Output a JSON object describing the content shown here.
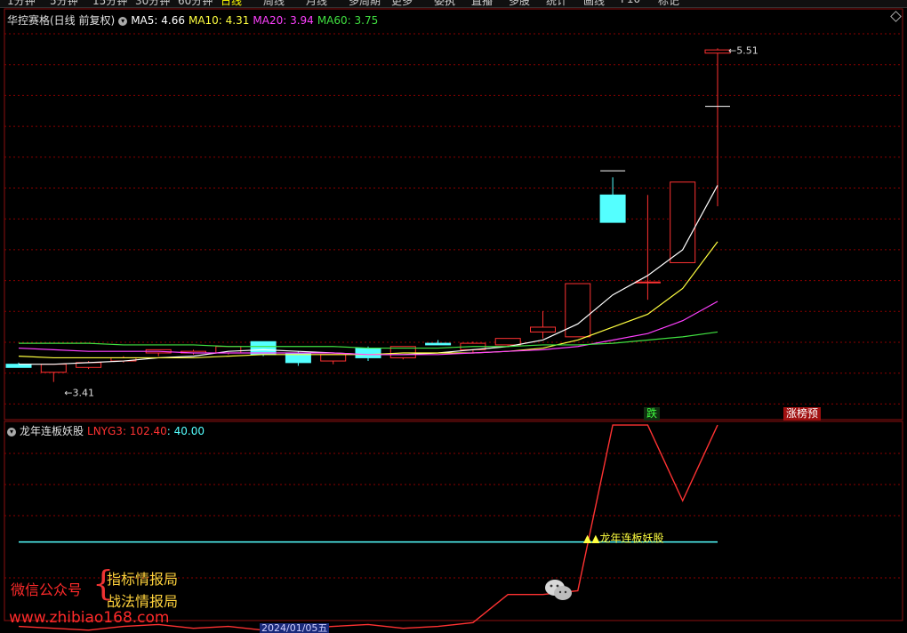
{
  "top_strip": {
    "items": [
      "1分钟",
      "5分钟",
      "15分钟",
      "30分钟",
      "60分钟",
      "日线",
      "周线",
      "月线",
      "多周期",
      "更多",
      "委执",
      "直播",
      "多股",
      "统计",
      "画线",
      "F10",
      "标记"
    ],
    "highlighted": "日线"
  },
  "main_panel": {
    "title": "华控赛格(日线 前复权)",
    "ma_labels": [
      {
        "text": "MA5: 4.66",
        "color": "#ffffff"
      },
      {
        "text": "MA10: 4.31",
        "color": "#ffff40"
      },
      {
        "text": "MA20: 3.94",
        "color": "#ff40ff"
      },
      {
        "text": "MA60: 3.75",
        "color": "#40e040"
      }
    ],
    "high_label": "5.51",
    "low_label": "3.41",
    "signal_die": "跌",
    "signal_zt": "涨榜预"
  },
  "indicator_panel": {
    "title": "龙年连板妖股",
    "value_label_1": "LNYG3: 102.40",
    "value_label_2": ": 40.00",
    "signal_text": "▲▲龙年连板妖股"
  },
  "watermark": {
    "line_1": "微信公众号",
    "line_2": "指标情报局",
    "line_3": "战法情报局",
    "url": "www.zhibiao168.com"
  },
  "date_badge": "2024/01/05五",
  "colors": {
    "up": "#ff3232",
    "down": "#54ffff",
    "ma5": "#ffffff",
    "ma10": "#ffff40",
    "ma20": "#ff40ff",
    "ma60": "#40e040",
    "grid": "#8b0000",
    "line40": "#54ffff",
    "lnyg": "#ff3232"
  },
  "chart_data": [
    {
      "type": "candlestick",
      "title": "华控赛格(日线 前复权)",
      "ylim": [
        3.3,
        5.6
      ],
      "candles": [
        {
          "o": 3.55,
          "h": 3.56,
          "l": 3.55,
          "c": 3.53
        },
        {
          "o": 3.5,
          "h": 3.54,
          "l": 3.44,
          "c": 3.55
        },
        {
          "o": 3.53,
          "h": 3.57,
          "l": 3.52,
          "c": 3.56
        },
        {
          "o": 3.57,
          "h": 3.6,
          "l": 3.56,
          "c": 3.59
        },
        {
          "o": 3.62,
          "h": 3.64,
          "l": 3.6,
          "c": 3.64
        },
        {
          "o": 3.62,
          "h": 3.64,
          "l": 3.61,
          "c": 3.63
        },
        {
          "o": 3.62,
          "h": 3.66,
          "l": 3.61,
          "c": 3.66
        },
        {
          "o": 3.69,
          "h": 3.69,
          "l": 3.6,
          "c": 3.61
        },
        {
          "o": 3.62,
          "h": 3.63,
          "l": 3.54,
          "c": 3.56
        },
        {
          "o": 3.57,
          "h": 3.61,
          "l": 3.55,
          "c": 3.61
        },
        {
          "o": 3.65,
          "h": 3.66,
          "l": 3.57,
          "c": 3.59
        },
        {
          "o": 3.59,
          "h": 3.66,
          "l": 3.58,
          "c": 3.66
        },
        {
          "o": 3.68,
          "h": 3.7,
          "l": 3.67,
          "c": 3.67
        },
        {
          "o": 3.64,
          "h": 3.69,
          "l": 3.62,
          "c": 3.68
        },
        {
          "o": 3.67,
          "h": 3.71,
          "l": 3.66,
          "c": 3.71
        },
        {
          "o": 3.75,
          "h": 3.88,
          "l": 3.71,
          "c": 3.78
        },
        {
          "o": 3.72,
          "h": 4.05,
          "l": 3.72,
          "c": 4.05
        },
        {
          "o": 4.6,
          "h": 4.71,
          "l": 4.43,
          "c": 4.43
        },
        {
          "o": 4.06,
          "h": 4.6,
          "l": 3.95,
          "c": 4.06
        },
        {
          "o": 4.18,
          "h": 4.68,
          "l": 4.18,
          "c": 4.68
        },
        {
          "o": 5.48,
          "h": 5.51,
          "l": 4.53,
          "c": 5.5
        }
      ],
      "dash_marks": [
        {
          "index": 17,
          "value": 4.75
        },
        {
          "index": 20,
          "value": 5.15
        }
      ],
      "series": [
        {
          "name": "MA5",
          "values": [
            3.55,
            3.55,
            3.56,
            3.57,
            3.59,
            3.6,
            3.63,
            3.64,
            3.63,
            3.62,
            3.61,
            3.61,
            3.62,
            3.64,
            3.66,
            3.7,
            3.8,
            3.98,
            4.1,
            4.26,
            4.66
          ]
        },
        {
          "name": "MA10",
          "values": [
            3.6,
            3.59,
            3.59,
            3.59,
            3.59,
            3.59,
            3.6,
            3.61,
            3.61,
            3.61,
            3.61,
            3.62,
            3.62,
            3.62,
            3.63,
            3.65,
            3.7,
            3.78,
            3.86,
            4.02,
            4.31
          ]
        },
        {
          "name": "MA20",
          "values": [
            3.65,
            3.64,
            3.63,
            3.63,
            3.63,
            3.62,
            3.62,
            3.62,
            3.62,
            3.62,
            3.61,
            3.61,
            3.61,
            3.62,
            3.63,
            3.64,
            3.66,
            3.7,
            3.74,
            3.82,
            3.94
          ]
        },
        {
          "name": "MA60",
          "values": [
            3.68,
            3.68,
            3.68,
            3.67,
            3.67,
            3.67,
            3.66,
            3.66,
            3.66,
            3.66,
            3.65,
            3.65,
            3.65,
            3.66,
            3.66,
            3.67,
            3.67,
            3.68,
            3.7,
            3.72,
            3.75
          ]
        }
      ]
    },
    {
      "type": "line",
      "title": "龙年连板妖股",
      "ylim": [
        0,
        110
      ],
      "series": [
        {
          "name": "LNYG3",
          "values": [
            -5,
            -6,
            -7,
            -5,
            -4,
            -6,
            -5,
            -7,
            -6,
            -5,
            -4,
            -6,
            -5,
            -3,
            12,
            12,
            14,
            102.4,
            102.4,
            62,
            102.4
          ]
        },
        {
          "name": "",
          "values": [
            40,
            40,
            40,
            40,
            40,
            40,
            40,
            40,
            40,
            40,
            40,
            40,
            40,
            40,
            40,
            40,
            40,
            40,
            40,
            40,
            40
          ]
        }
      ]
    }
  ]
}
